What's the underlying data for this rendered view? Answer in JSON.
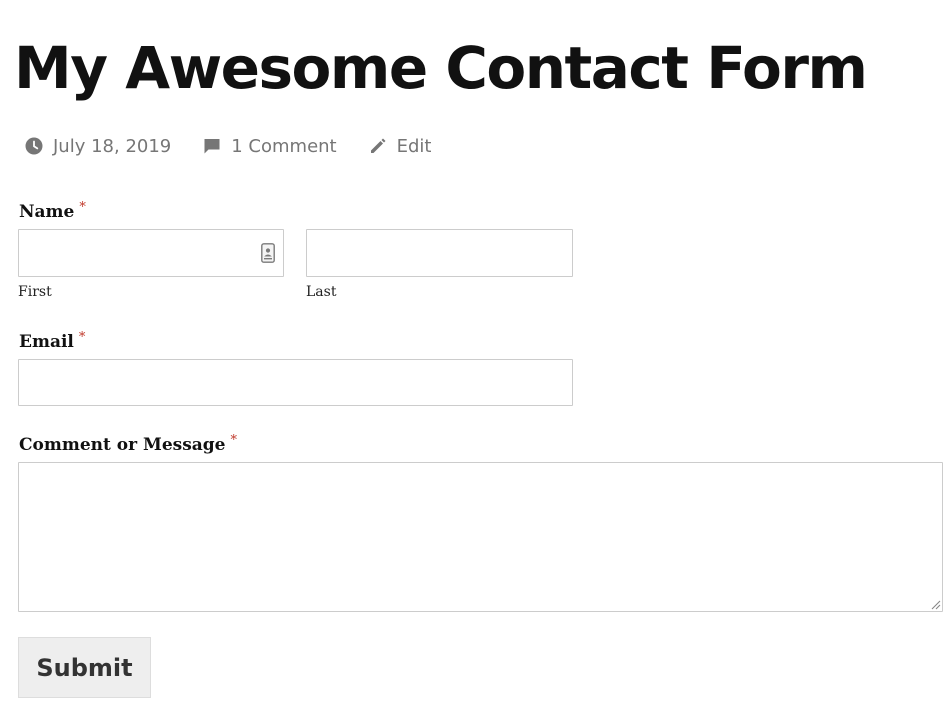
{
  "page": {
    "title": "My Awesome Contact Form"
  },
  "meta": {
    "date": "July 18, 2019",
    "comments": "1 Comment",
    "edit": "Edit",
    "icons": [
      "clock-icon",
      "comment-icon",
      "pencil-icon"
    ],
    "icon_color": "#767676"
  },
  "form": {
    "name": {
      "label": "Name",
      "required_mark": "*",
      "first_sublabel": "First",
      "last_sublabel": "Last",
      "first_value": "",
      "last_value": ""
    },
    "email": {
      "label": "Email",
      "required_mark": "*",
      "value": ""
    },
    "message": {
      "label": "Comment or Message",
      "required_mark": "*",
      "value": ""
    },
    "submit_label": "Submit",
    "required_color": "#c0392b"
  }
}
